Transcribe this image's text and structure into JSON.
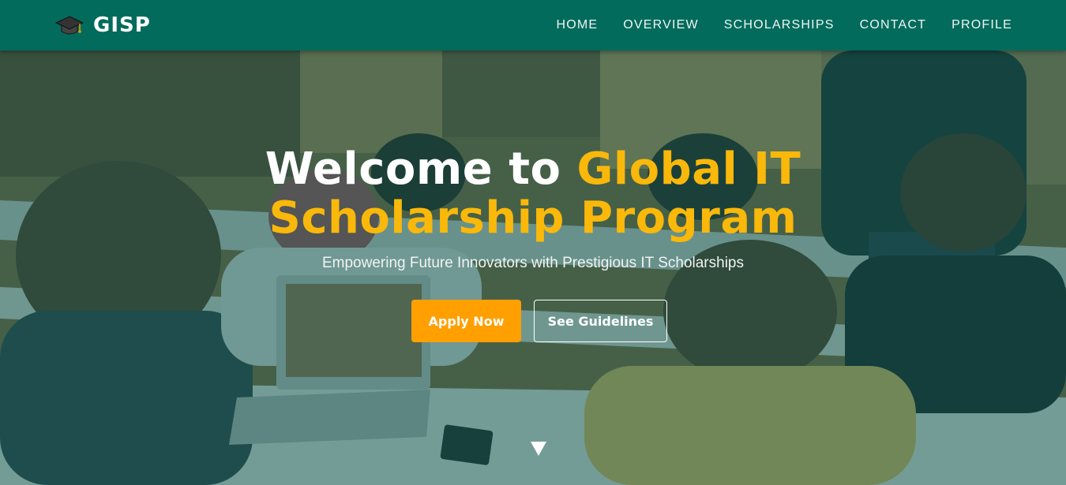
{
  "brand": {
    "name": "GISP",
    "icon": "graduation-cap-icon"
  },
  "nav": {
    "items": [
      {
        "label": "HOME"
      },
      {
        "label": "OVERVIEW"
      },
      {
        "label": "SCHOLARSHIPS"
      },
      {
        "label": "CONTACT"
      },
      {
        "label": "PROFILE"
      }
    ]
  },
  "hero": {
    "title_white": "Welcome to ",
    "title_gold_1": "Global IT",
    "title_gold_2": "Scholarship Program",
    "subtitle": "Empowering Future Innovators with Prestigious IT Scholarships",
    "apply_label": "Apply Now",
    "guidelines_label": "See Guidelines",
    "scroll_icon": "triangle-down-icon"
  },
  "colors": {
    "navbar": "#036b5c",
    "accent_gold": "#f9b80a",
    "apply_button": "#ff9f00",
    "overlay": "#0e5850"
  }
}
